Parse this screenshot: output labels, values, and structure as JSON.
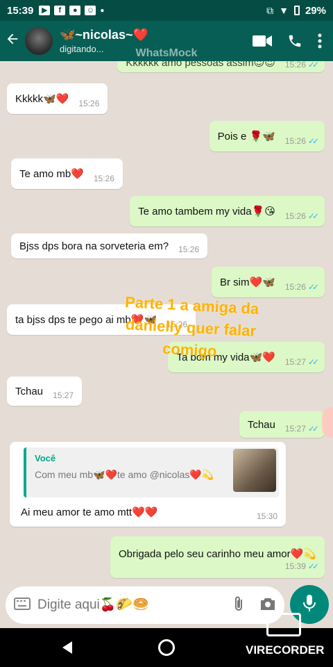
{
  "status_bar": {
    "time": "15:39",
    "battery": "29%",
    "icons": [
      "youtube-icon",
      "facebook-icon",
      "app-icon",
      "app-icon",
      "dot-icon"
    ],
    "right_icons": [
      "cast-icon",
      "wifi-icon",
      "battery-icon"
    ]
  },
  "header": {
    "contact_name": "🦋~nicolas~❤️",
    "status": "digitando...",
    "icons": [
      "back-arrow-icon",
      "video-call-icon",
      "phone-icon",
      "more-vert-icon"
    ]
  },
  "watermark": "WhatsMock",
  "messages": [
    {
      "dir": "out",
      "text": "Kkkkkk amo pessoas assim😍😍",
      "time": "15:26",
      "ticks": "✓✓"
    },
    {
      "dir": "in",
      "text": "Kkkkk🦋❤️",
      "time": "15:26"
    },
    {
      "dir": "out",
      "text": "Pois e 🌹🦋",
      "time": "15:26",
      "ticks": "✓✓"
    },
    {
      "dir": "in",
      "text": "Te amo mb❤️",
      "time": "15:26"
    },
    {
      "dir": "out",
      "text": "Te amo tambem my vida🌹😘",
      "time": "15:26",
      "ticks": "✓✓"
    },
    {
      "dir": "in",
      "text": "Bjss dps bora na sorveteria em?",
      "time": "15:26"
    },
    {
      "dir": "out",
      "text": "Br sim❤️🦋",
      "time": "15:26",
      "ticks": "✓✓"
    },
    {
      "dir": "in",
      "text": "ta bjss dps te pego ai mb❤️🦋",
      "time": "15:26"
    },
    {
      "dir": "out",
      "text": "Ta bom my vida🦋❤️",
      "time": "15:27",
      "ticks": "✓✓"
    },
    {
      "dir": "in",
      "text": "Tchau",
      "time": "15:27"
    },
    {
      "dir": "out",
      "text": "Tchau",
      "time": "15:27",
      "ticks": "✓✓"
    },
    {
      "dir": "out",
      "text": "Obrigada pelo seu carinho meu amor❤️💫",
      "time": "15:39",
      "ticks": "✓✓"
    }
  ],
  "reply_message": {
    "quoted_author": "Você",
    "quoted_text": "Com meu mb🦋❤️te amo @nicolas❤️💫",
    "text": "Ai meu amor te amo mtt❤️❤️",
    "time": "15:30"
  },
  "overlay_text": "Parte 1 a amiga da danielly quer falar comigo",
  "composer": {
    "placeholder": "Digite aqui🍒🌮🥯"
  },
  "recorder_label": "VIRECORDER",
  "colors": {
    "header": "#075e54",
    "status_bar": "#054d44",
    "outgoing_bubble": "#dcf8c6",
    "incoming_bubble": "#ffffff",
    "chat_background": "#e5ddd5",
    "accent": "#00897b",
    "read_ticks": "#34b7f1",
    "overlay_text": "#ffb300"
  }
}
